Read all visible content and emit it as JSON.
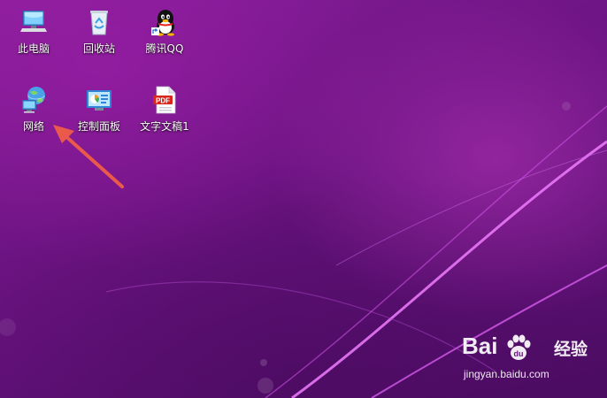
{
  "desktop": {
    "icons": [
      {
        "id": "this-pc",
        "label": "此电脑",
        "icon": "computer-icon"
      },
      {
        "id": "recycle-bin",
        "label": "回收站",
        "icon": "recycle-bin-icon"
      },
      {
        "id": "tencent-qq",
        "label": "腾讯QQ",
        "icon": "qq-penguin-icon"
      },
      {
        "id": "network",
        "label": "网络",
        "icon": "network-globe-icon"
      },
      {
        "id": "control-panel",
        "label": "控制面板",
        "icon": "control-panel-icon"
      },
      {
        "id": "text-document",
        "label": "文字文稿1",
        "icon": "pdf-document-icon"
      }
    ]
  },
  "annotation": {
    "type": "arrow",
    "color": "#ea5a4a",
    "points_to": "网络"
  },
  "watermark": {
    "brand": "Bai du",
    "name_cn": "经验",
    "url": "jingyan.baidu.com"
  },
  "colors": {
    "wallpaper": "#6a1580",
    "accent_line": "#e070f0",
    "arrow": "#ea5a4a"
  }
}
